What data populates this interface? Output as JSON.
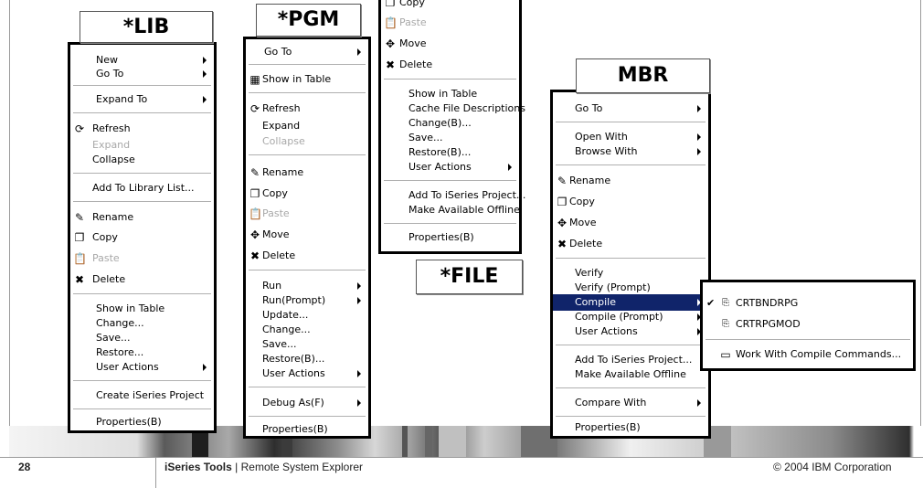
{
  "labels": {
    "lib": "*LIB",
    "pgm": "*PGM",
    "file": "*FILE",
    "mbr": "MBR"
  },
  "lib_menu": {
    "new": "New",
    "go_to": "Go To",
    "expand_to": "Expand To",
    "refresh": "Refresh",
    "expand": "Expand",
    "collapse": "Collapse",
    "add_to_library_list": "Add To Library List...",
    "rename": "Rename",
    "copy": "Copy",
    "paste": "Paste",
    "delete": "Delete",
    "show_in_table": "Show in Table",
    "change": "Change...",
    "save": "Save...",
    "restore": "Restore...",
    "user_actions": "User Actions",
    "create_project": "Create iSeries Project",
    "properties": "Properties(B)"
  },
  "pgm_menu": {
    "go_to": "Go To",
    "show_in_table": "Show in Table",
    "refresh": "Refresh",
    "expand": "Expand",
    "collapse": "Collapse",
    "rename": "Rename",
    "copy": "Copy",
    "paste": "Paste",
    "move": "Move",
    "delete": "Delete",
    "run": "Run",
    "run_prompt": "Run(Prompt)",
    "update": "Update...",
    "change": "Change...",
    "save": "Save...",
    "restore": "Restore(B)...",
    "user_actions": "User Actions",
    "debug_as": "Debug As(F)",
    "properties": "Properties(B)"
  },
  "file_menu": {
    "copy": "Copy",
    "paste": "Paste",
    "move": "Move",
    "delete": "Delete",
    "show_in_table": "Show in Table",
    "cache": "Cache File Descriptions",
    "change": "Change(B)...",
    "save": "Save...",
    "restore": "Restore(B)...",
    "user_actions": "User Actions",
    "add_project": "Add To iSeries Project...",
    "offline": "Make Available Offline",
    "properties": "Properties(B)"
  },
  "mbr_menu": {
    "go_to": "Go To",
    "open_with": "Open With",
    "browse_with": "Browse With",
    "rename": "Rename",
    "copy": "Copy",
    "move": "Move",
    "delete": "Delete",
    "verify": "Verify",
    "verify_prompt": "Verify (Prompt)",
    "compile": "Compile",
    "compile_prompt": "Compile (Prompt)",
    "user_actions": "User Actions",
    "add_project": "Add To iSeries Project...",
    "offline": "Make Available Offline",
    "compare_with": "Compare With",
    "properties": "Properties(B)"
  },
  "compile_submenu": {
    "check": "✔",
    "crtbndrpg": "CRTBNDRPG",
    "crtrpgmod": "CRTRPGMOD",
    "work_with": "Work With Compile Commands..."
  },
  "footer": {
    "page": "28",
    "product_bold": "iSeries Tools",
    "product_rest": "|  Remote System Explorer",
    "copyright": "© 2004 IBM Corporation"
  },
  "colors": {
    "selection": "#10246a",
    "delete_icon": "#000000"
  }
}
